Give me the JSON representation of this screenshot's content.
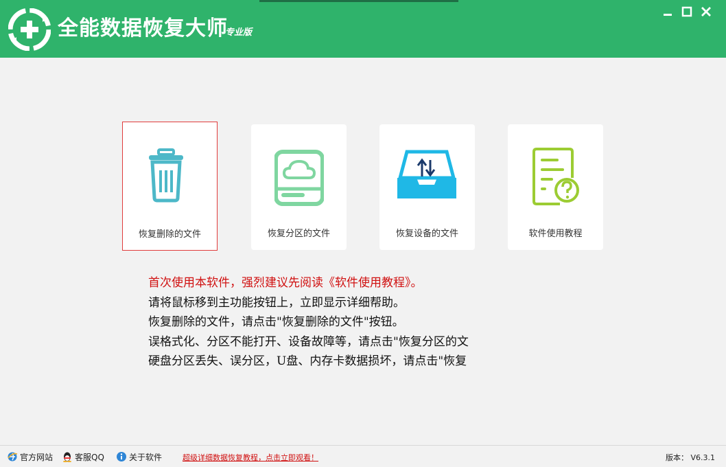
{
  "app": {
    "title": "全能数据恢复大师",
    "edition": "专业版"
  },
  "colors": {
    "brand_green": "#2fb36b",
    "active_border": "#e03b3b",
    "notice_red": "#d01010"
  },
  "cards": [
    {
      "label": "恢复删除的文件",
      "icon": "trash-icon",
      "color": "#4db8c8"
    },
    {
      "label": "恢复分区的文件",
      "icon": "disk-cloud-icon",
      "color": "#7fd6a0"
    },
    {
      "label": "恢复设备的文件",
      "icon": "device-sync-icon",
      "color": "#1fb8e6"
    },
    {
      "label": "软件使用教程",
      "icon": "document-help-icon",
      "color": "#9ccc33"
    }
  ],
  "notes": [
    "首次使用本软件，强烈建议先阅读《软件使用教程》。",
    "请将鼠标移到主功能按钮上，立即显示详细帮助。",
    "恢复删除的文件，请点击\"恢复删除的文件\"按钮。",
    "误格式化、分区不能打开、设备故障等，请点击\"恢复分区的文",
    "硬盘分区丢失、误分区，U盘、内存卡数据损坏，请点击\"恢复"
  ],
  "statusbar": {
    "website": "官方网站",
    "support_qq": "客服QQ",
    "about": "关于软件",
    "tutorial_link": "超级详细数据恢复教程，点击立即观看！",
    "version": "版本： V6.3.1"
  }
}
